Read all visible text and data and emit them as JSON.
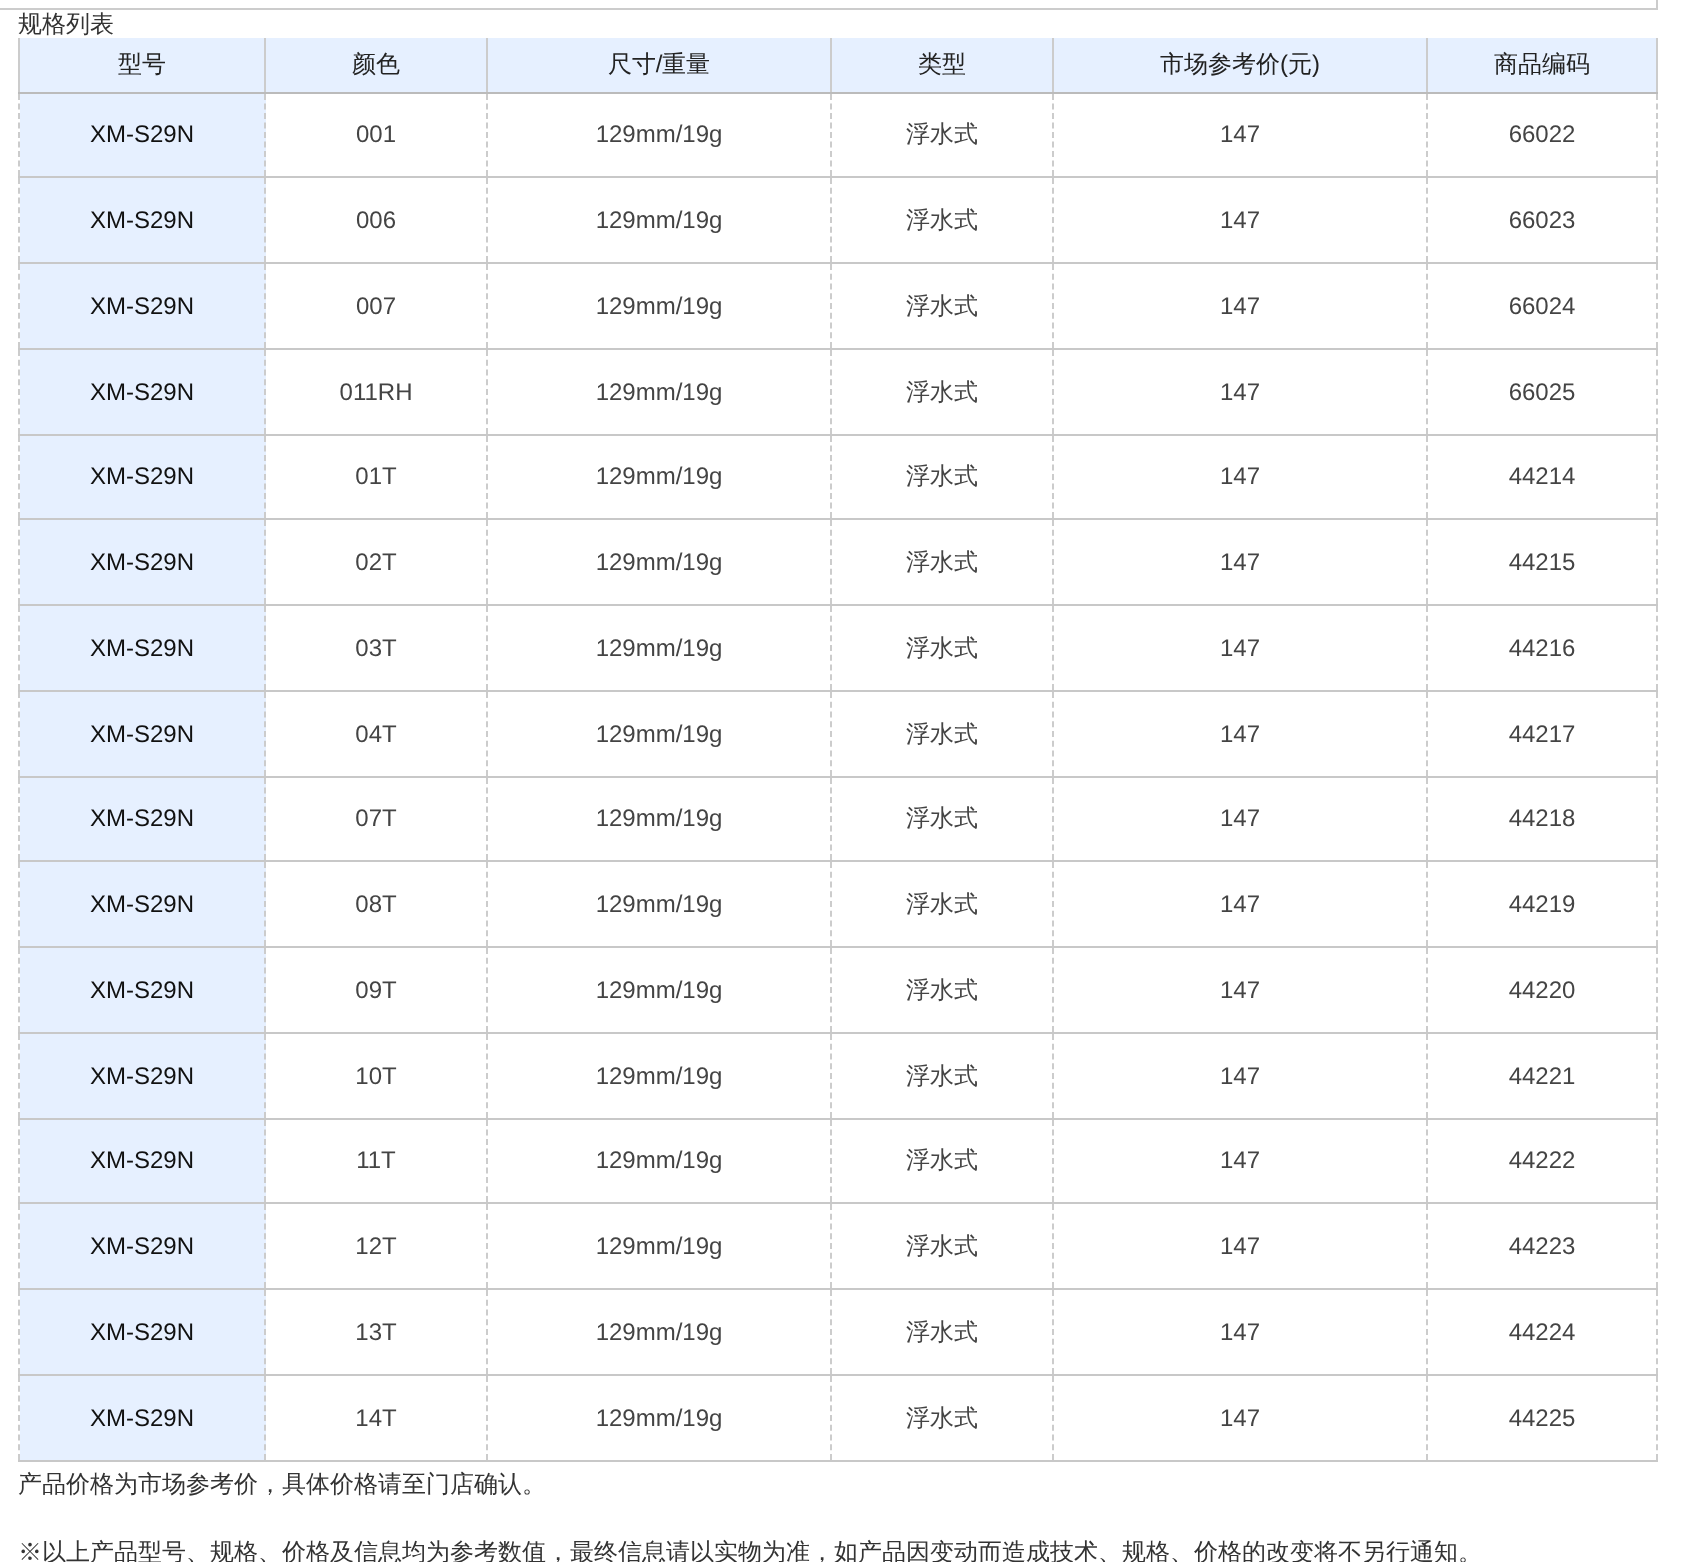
{
  "title": "规格列表",
  "table": {
    "columns": [
      "型号",
      "颜色",
      "尺寸/重量",
      "类型",
      "市场参考价(元)",
      "商品编码"
    ],
    "rows": [
      [
        "XM-S29N",
        "001",
        "129mm/19g",
        "浮水式",
        "147",
        "66022"
      ],
      [
        "XM-S29N",
        "006",
        "129mm/19g",
        "浮水式",
        "147",
        "66023"
      ],
      [
        "XM-S29N",
        "007",
        "129mm/19g",
        "浮水式",
        "147",
        "66024"
      ],
      [
        "XM-S29N",
        "011RH",
        "129mm/19g",
        "浮水式",
        "147",
        "66025"
      ],
      [
        "XM-S29N",
        "01T",
        "129mm/19g",
        "浮水式",
        "147",
        "44214"
      ],
      [
        "XM-S29N",
        "02T",
        "129mm/19g",
        "浮水式",
        "147",
        "44215"
      ],
      [
        "XM-S29N",
        "03T",
        "129mm/19g",
        "浮水式",
        "147",
        "44216"
      ],
      [
        "XM-S29N",
        "04T",
        "129mm/19g",
        "浮水式",
        "147",
        "44217"
      ],
      [
        "XM-S29N",
        "07T",
        "129mm/19g",
        "浮水式",
        "147",
        "44218"
      ],
      [
        "XM-S29N",
        "08T",
        "129mm/19g",
        "浮水式",
        "147",
        "44219"
      ],
      [
        "XM-S29N",
        "09T",
        "129mm/19g",
        "浮水式",
        "147",
        "44220"
      ],
      [
        "XM-S29N",
        "10T",
        "129mm/19g",
        "浮水式",
        "147",
        "44221"
      ],
      [
        "XM-S29N",
        "11T",
        "129mm/19g",
        "浮水式",
        "147",
        "44222"
      ],
      [
        "XM-S29N",
        "12T",
        "129mm/19g",
        "浮水式",
        "147",
        "44223"
      ],
      [
        "XM-S29N",
        "13T",
        "129mm/19g",
        "浮水式",
        "147",
        "44224"
      ],
      [
        "XM-S29N",
        "14T",
        "129mm/19g",
        "浮水式",
        "147",
        "44225"
      ]
    ]
  },
  "notes": [
    "产品价格为市场参考价，具体价格请至门店确认。",
    "※以上产品型号、规格、价格及信息均为参考数值，最终信息请以实物为准，如产品因变动而造成技术、规格、价格的改变将不另行通知。"
  ]
}
